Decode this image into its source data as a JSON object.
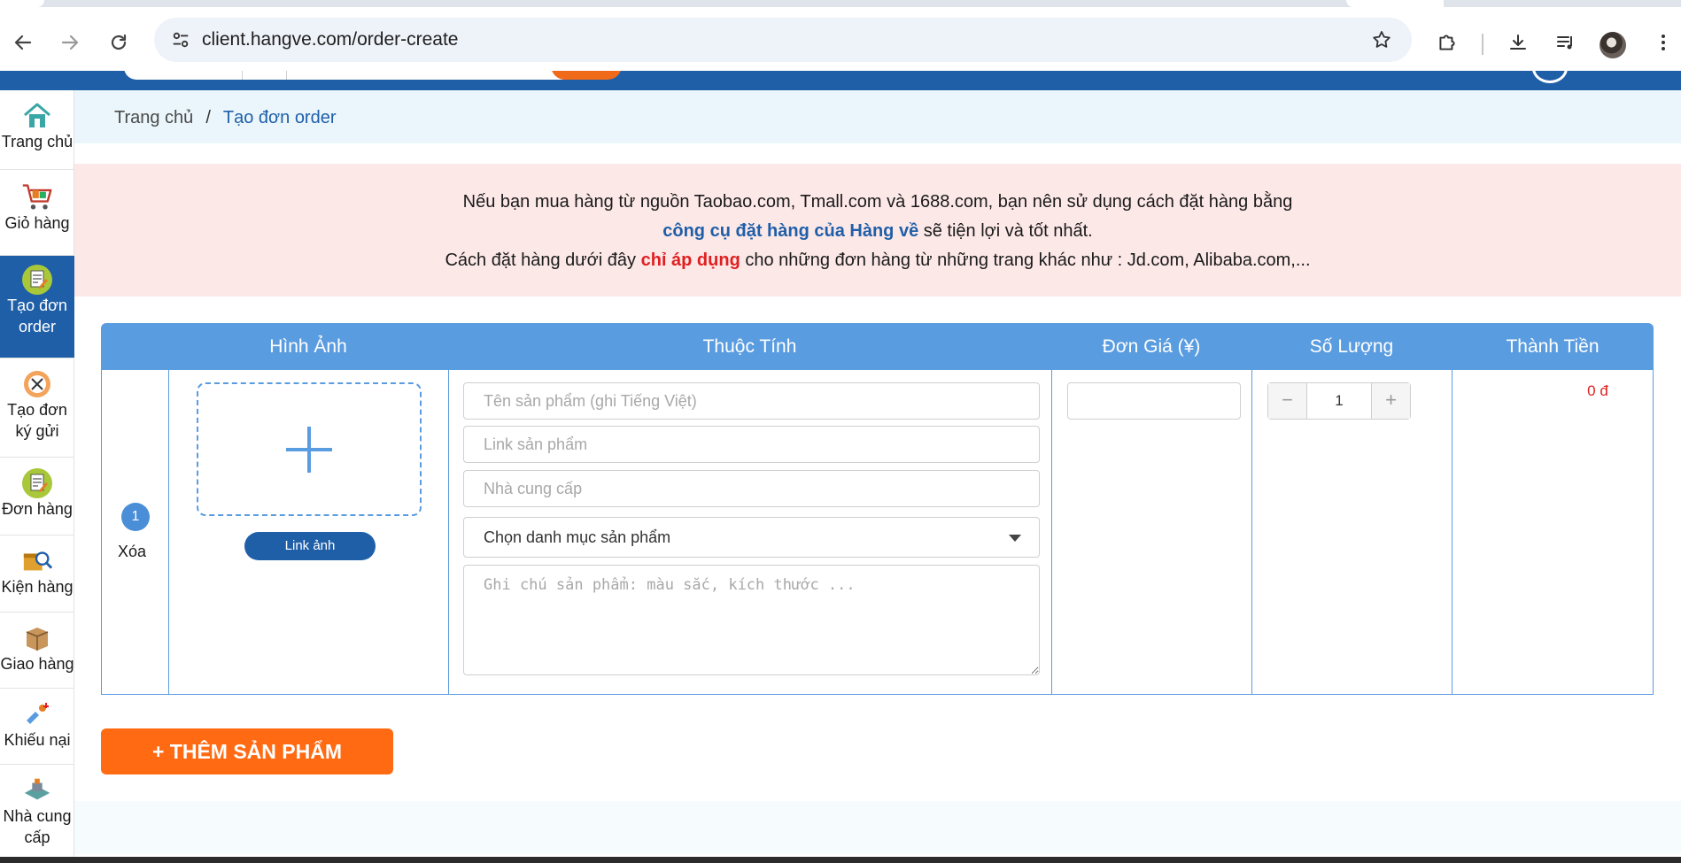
{
  "browser": {
    "url": "client.hangve.com/order-create"
  },
  "sidebar": {
    "items": [
      {
        "label": "Trang chủ",
        "icon": "home-icon"
      },
      {
        "label": "Giỏ hàng",
        "icon": "cart-icon"
      },
      {
        "label": "Tạo đơn order",
        "icon": "create-order-icon",
        "active": true
      },
      {
        "label": "Tạo đơn ký gửi",
        "icon": "consignment-icon"
      },
      {
        "label": "Đơn hàng",
        "icon": "orders-icon"
      },
      {
        "label": "Kiện hàng",
        "icon": "package-search-icon"
      },
      {
        "label": "Giao hàng",
        "icon": "delivery-box-icon"
      },
      {
        "label": "Khiếu nại",
        "icon": "complaint-icon"
      },
      {
        "label": "Nhà cung cấp",
        "icon": "supplier-icon"
      }
    ]
  },
  "breadcrumb": {
    "home": "Trang chủ",
    "separator": "/",
    "current": "Tạo đơn order"
  },
  "notice": {
    "line1": "Nếu bạn mua hàng từ nguồn Taobao.com, Tmall.com và 1688.com, bạn nên sử dụng cách đặt hàng bằng",
    "line2_link": "công cụ đặt hàng của Hàng về",
    "line2_rest": " sẽ tiện lợi và tốt nhất.",
    "line3_pre": "Cách đặt hàng dưới đây ",
    "line3_highlight": "chỉ áp dụng",
    "line3_post": " cho những đơn hàng từ những trang khác như : Jd.com, Alibaba.com,..."
  },
  "table": {
    "headers": {
      "image": "Hình Ảnh",
      "attributes": "Thuộc Tính",
      "unit_price": "Đơn Giá (¥)",
      "quantity": "Số Lượng",
      "total": "Thành Tiền"
    },
    "row": {
      "index": "1",
      "delete_label": "Xóa",
      "link_image_label": "Link ảnh",
      "product_name_placeholder": "Tên sản phẩm (ghi Tiếng Việt)",
      "product_link_placeholder": "Link sản phẩm",
      "supplier_placeholder": "Nhà cung cấp",
      "category_selected": "Chọn danh mục sản phẩm",
      "note_placeholder": "Ghi chú sản phẩm: màu sắc, kích thước ...",
      "quantity_value": "1",
      "minus_label": "−",
      "plus_label": "+",
      "total_value": "0 đ"
    }
  },
  "add_product_label": "+ THÊM SẢN PHẨM",
  "colors": {
    "brand_blue": "#1f5fa8",
    "header_blue": "#5a9ce0",
    "accent_orange": "#ff6a12",
    "notice_bg": "#fde8e8",
    "danger_red": "#e02020"
  }
}
